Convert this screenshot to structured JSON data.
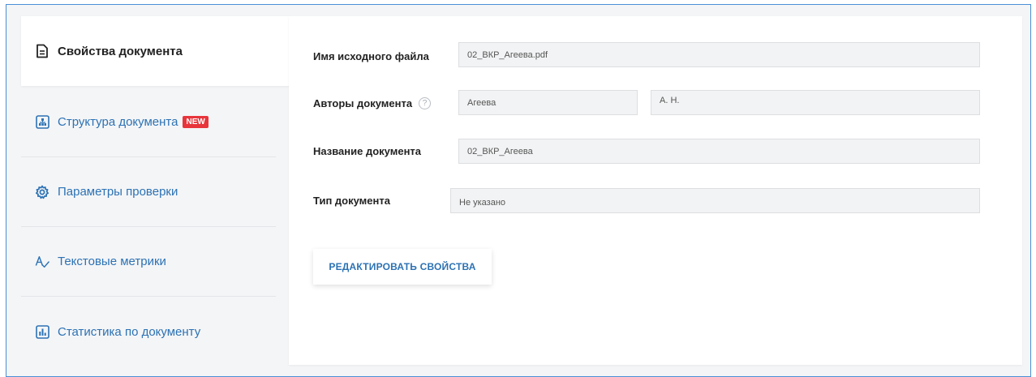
{
  "sidebar": {
    "items": [
      {
        "label": "Свойства документа",
        "icon": "document-icon",
        "active": true
      },
      {
        "label": "Структура документа",
        "icon": "structure-icon",
        "badge": "NEW"
      },
      {
        "label": "Параметры проверки",
        "icon": "gear-icon"
      },
      {
        "label": "Текстовые метрики",
        "icon": "text-metrics-icon"
      },
      {
        "label": "Статистика по документу",
        "icon": "bar-chart-icon"
      }
    ]
  },
  "form": {
    "source_file": {
      "label": "Имя исходного файла",
      "value": "02_ВКР_Агеева.pdf"
    },
    "authors": {
      "label": "Авторы документа",
      "help": "?",
      "last_name": "Агеева",
      "initials": "А. Н."
    },
    "title": {
      "label": "Название документа",
      "value": "02_ВКР_Агеева"
    },
    "type": {
      "label": "Тип документа",
      "value": "Не указано"
    },
    "edit_button": "РЕДАКТИРОВАТЬ СВОЙСТВА"
  },
  "colors": {
    "accent": "#2c72b4",
    "badge": "#e8343b",
    "frame_border": "#4a8fd6"
  }
}
